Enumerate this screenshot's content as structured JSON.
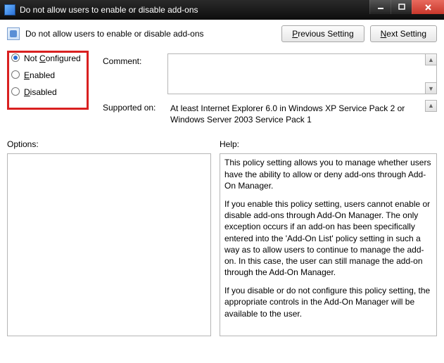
{
  "titlebar": {
    "text": "Do not allow users to enable or disable add-ons"
  },
  "header": {
    "title": "Do not allow users to enable or disable add-ons",
    "prev_button": "Previous Setting",
    "next_button": "Next Setting"
  },
  "states": {
    "not_configured": "Not Configured",
    "enabled": "Enabled",
    "disabled": "Disabled",
    "selected": "not_configured"
  },
  "fields": {
    "comment_label": "Comment:",
    "comment_value": "",
    "supported_label": "Supported on:",
    "supported_text": "At least Internet Explorer 6.0 in Windows XP Service Pack 2 or Windows Server 2003 Service Pack 1"
  },
  "lower": {
    "options_label": "Options:",
    "help_label": "Help:",
    "help_p1": "This policy setting allows you to manage whether users have the ability to allow or deny add-ons through Add-On Manager.",
    "help_p2": "If you enable this policy setting, users cannot enable or disable add-ons through Add-On Manager. The only exception occurs if an add-on has been specifically entered into the 'Add-On List' policy setting in such a way as to allow users to continue to manage the add-on. In this case, the user can still manage the add-on through the Add-On Manager.",
    "help_p3": "If you disable or do not configure this policy setting, the appropriate controls in the Add-On Manager will be available to the user."
  }
}
